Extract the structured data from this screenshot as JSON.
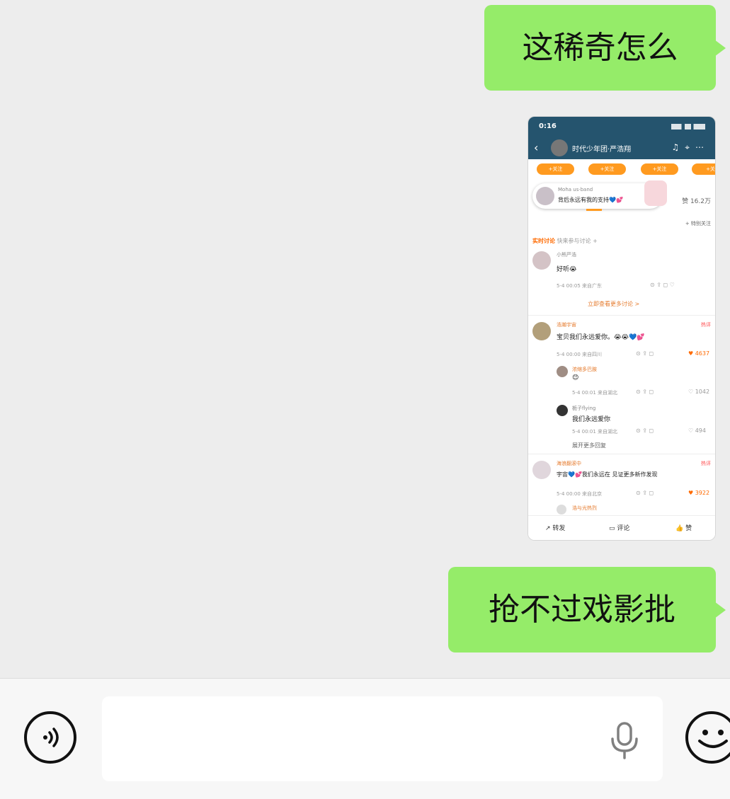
{
  "messages": [
    {
      "type": "text",
      "text": "这稀奇怎么"
    },
    {
      "type": "image"
    },
    {
      "type": "text",
      "text": "抢不过戏影批"
    }
  ],
  "shared_screenshot": {
    "status_time": "0:16",
    "nav_title": "时代少年团·严浩翔",
    "nav_icons": [
      "back-icon",
      "headphones-icon",
      "user-icon",
      "more-icon"
    ],
    "orange_buttons": [
      "+关注",
      "+关注",
      "+关注",
      "+关"
    ],
    "pinned": {
      "name": "Moha us·band",
      "text": "背后永远有我的支持💙💕"
    },
    "likes": "赞 16.2万",
    "follow_link": "+ 特别关注",
    "section_title": "实时讨论",
    "section_subtitle": "快来参与讨论 +",
    "comments": [
      {
        "name": "小熊严浩",
        "text": "好听😭",
        "meta": "5-4 00:05 来自广东",
        "count": "",
        "hot": ""
      },
      {
        "name": "浩瀚宇宙",
        "text": "宝贝我们永远爱你。😭😭💙💕",
        "meta": "5-4 00:00 来自四川",
        "count": "4637",
        "hot": "热评"
      },
      {
        "name": "浓缩多巴胺",
        "text": "😊",
        "meta": "5-4 00:01 来自湖北",
        "count": "1042",
        "hot": ""
      },
      {
        "name": "栀子flying",
        "text": "我们永远爱你",
        "meta": "5-4 00:01 来自湖北",
        "count": "494",
        "hot": ""
      },
      {
        "name": "海浪翻滚中",
        "text": "宇宙💙💕我们永远在 见证更多新作发现",
        "meta": "5-4 00:00 来自北京",
        "count": "3922",
        "hot": "热评"
      }
    ],
    "more_replies": "展开更多回复",
    "view_more": "立即查看更多讨论 >",
    "last_name": "浩与光热烈",
    "bottom_actions": [
      "转发",
      "评论",
      "赞"
    ]
  },
  "input_bar": {
    "text_value": "",
    "icons": [
      "voice-icon",
      "mic-icon",
      "emoji-icon"
    ]
  }
}
